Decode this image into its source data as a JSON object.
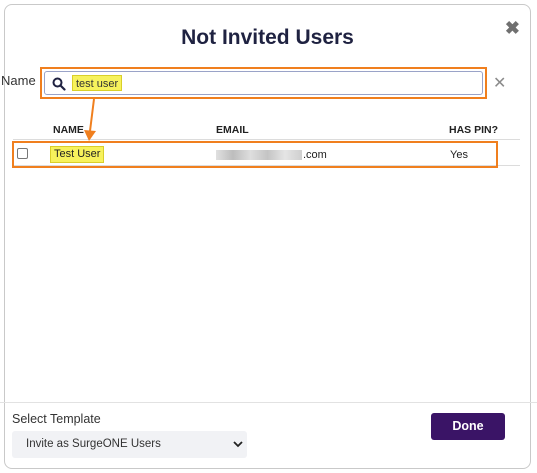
{
  "dialog": {
    "title": "Not Invited Users",
    "close_icon": "close-icon"
  },
  "search": {
    "label": "Name",
    "value": "test user",
    "search_icon": "search-icon",
    "clear_icon": "clear-icon"
  },
  "table": {
    "columns": [
      "NAME",
      "EMAIL",
      "HAS PIN?"
    ],
    "rows": [
      {
        "checked": false,
        "name": "Test User",
        "email_suffix": ".com",
        "has_pin": "Yes"
      }
    ]
  },
  "footer": {
    "select_label": "Select Template",
    "template_selected": "Invite as SurgeONE Users",
    "done_label": "Done"
  },
  "colors": {
    "accent": "#3a1466",
    "annotation": "#f07f1e",
    "highlight": "#f7f25c",
    "title": "#1f2241"
  }
}
